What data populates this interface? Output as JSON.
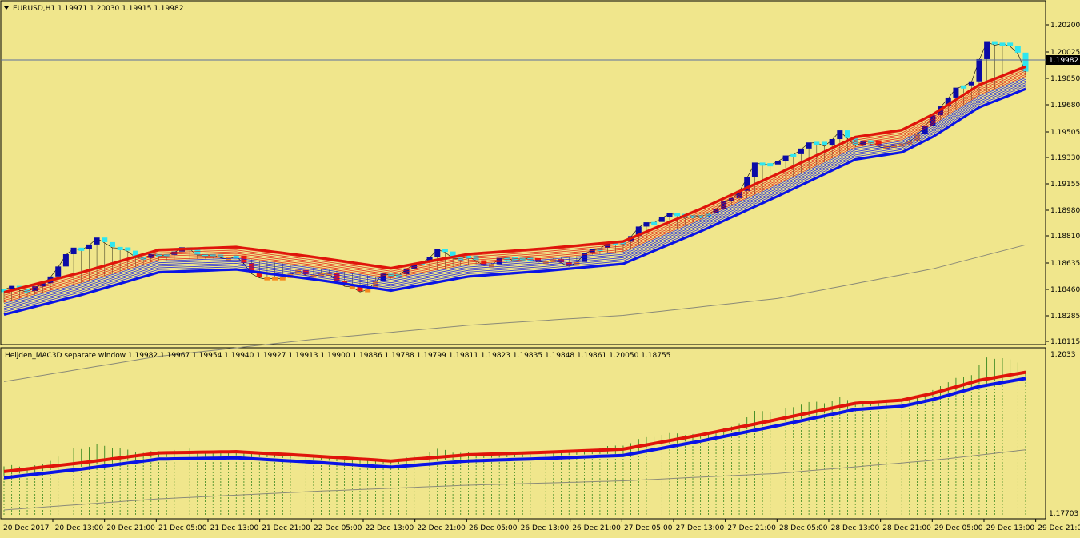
{
  "colors": {
    "background": "#f0e68c",
    "frame": "#000000",
    "bull_body": "#0b0ba6",
    "bull_small": "#2ee6f0",
    "bear_body": "#f01a10",
    "bear_small": "#f5891c",
    "blue_ribbon": "#0a14e6",
    "red_ribbon": "#e0140a",
    "slow_line": "#8a8a78",
    "bid_line": "#5a6e9e",
    "wick": "#000000",
    "price_tag_bg": "#000000",
    "price_tag_text": "#ffffff",
    "histogram": "#1e7a10"
  },
  "main_panel": {
    "title": "EURUSD,H1  1.19971 1.20030 1.19915 1.19982",
    "title_icon": "triangle-down-icon",
    "bid_label": "1.19982",
    "y_axis_labels": [
      "1.20200",
      "1.20025",
      "1.19850",
      "1.19680",
      "1.19505",
      "1.19330",
      "1.19155",
      "1.18980",
      "1.18810",
      "1.18635",
      "1.18460",
      "1.18285",
      "1.18115"
    ]
  },
  "sub_panel": {
    "title": "Heijden_MAC3D separate window 1.19982 1.19967 1.19954 1.19940 1.19927 1.19913 1.19900 1.19886 1.19788 1.19799 1.19811 1.19823 1.19835 1.19848 1.19861 1.20050 1.18755",
    "y_top_label": "1.2033",
    "y_bottom_label": "1.17703"
  },
  "time_axis": [
    "20 Dec 2017",
    "20 Dec 13:00",
    "20 Dec 21:00",
    "21 Dec 05:00",
    "21 Dec 13:00",
    "21 Dec 21:00",
    "22 Dec 05:00",
    "22 Dec 13:00",
    "22 Dec 21:00",
    "26 Dec 05:00",
    "26 Dec 13:00",
    "26 Dec 21:00",
    "27 Dec 05:00",
    "27 Dec 13:00",
    "27 Dec 21:00",
    "28 Dec 05:00",
    "28 Dec 13:00",
    "28 Dec 21:00",
    "29 Dec 05:00",
    "29 Dec 13:00",
    "29 Dec 21:00"
  ],
  "chart_data": {
    "type": "candlestick",
    "symbol": "EURUSD",
    "timeframe": "H1",
    "ohlc_last": {
      "open": 1.19971,
      "high": 1.2003,
      "low": 1.19915,
      "close": 1.19982
    },
    "ylim_main": [
      1.1806,
      1.2035
    ],
    "ylim_sub": [
      1.17703,
      1.2033
    ],
    "close_path": [
      [
        0,
        1.1842
      ],
      [
        5,
        1.1846
      ],
      [
        9,
        1.1872
      ],
      [
        12,
        1.1878
      ],
      [
        16,
        1.1869
      ],
      [
        20,
        1.1866
      ],
      [
        24,
        1.1873
      ],
      [
        27,
        1.1865
      ],
      [
        30,
        1.1866
      ],
      [
        34,
        1.1848
      ],
      [
        38,
        1.1856
      ],
      [
        42,
        1.1852
      ],
      [
        46,
        1.1842
      ],
      [
        49,
        1.1851
      ],
      [
        52,
        1.1858
      ],
      [
        56,
        1.1869
      ],
      [
        60,
        1.1866
      ],
      [
        63,
        1.1859
      ],
      [
        65,
        1.1867
      ],
      [
        68,
        1.1864
      ],
      [
        71,
        1.1862
      ],
      [
        74,
        1.1863
      ],
      [
        76,
        1.1871
      ],
      [
        79,
        1.1876
      ],
      [
        83,
        1.1889
      ],
      [
        87,
        1.1898
      ],
      [
        90,
        1.1893
      ],
      [
        94,
        1.1908
      ],
      [
        97,
        1.193
      ],
      [
        100,
        1.1934
      ],
      [
        103,
        1.1944
      ],
      [
        106,
        1.1946
      ],
      [
        108,
        1.1955
      ],
      [
        110,
        1.1947
      ],
      [
        113,
        1.1945
      ],
      [
        116,
        1.1946
      ],
      [
        119,
        1.1956
      ],
      [
        121,
        1.1975
      ],
      [
        123,
        1.1985
      ],
      [
        125,
        1.1991
      ],
      [
        127,
        1.2017
      ],
      [
        129,
        1.202
      ],
      [
        131,
        1.201
      ],
      [
        132,
        1.1998
      ]
    ],
    "ribbon_path": [
      [
        0,
        1.1834
      ],
      [
        10,
        1.1848
      ],
      [
        20,
        1.1864
      ],
      [
        30,
        1.1866
      ],
      [
        40,
        1.1859
      ],
      [
        50,
        1.1851
      ],
      [
        60,
        1.1861
      ],
      [
        70,
        1.1865
      ],
      [
        80,
        1.187
      ],
      [
        90,
        1.1893
      ],
      [
        100,
        1.1918
      ],
      [
        110,
        1.1944
      ],
      [
        116,
        1.1949
      ],
      [
        120,
        1.196
      ],
      [
        126,
        1.1981
      ],
      [
        132,
        1.1994
      ]
    ],
    "slow_path": [
      [
        0,
        1.1778
      ],
      [
        20,
        1.1796
      ],
      [
        40,
        1.1808
      ],
      [
        60,
        1.1818
      ],
      [
        80,
        1.1825
      ],
      [
        100,
        1.1837
      ],
      [
        120,
        1.1858
      ],
      [
        132,
        1.1875
      ]
    ],
    "bars_count": 133,
    "bid_price": 1.19982,
    "indicator_name": "Heijden_MAC3D",
    "indicator_values": [
      1.19982,
      1.19967,
      1.19954,
      1.1994,
      1.19927,
      1.19913,
      1.199,
      1.19886,
      1.19788,
      1.19799,
      1.19811,
      1.19823,
      1.19835,
      1.19848,
      1.19861,
      1.2005,
      1.18755
    ]
  }
}
